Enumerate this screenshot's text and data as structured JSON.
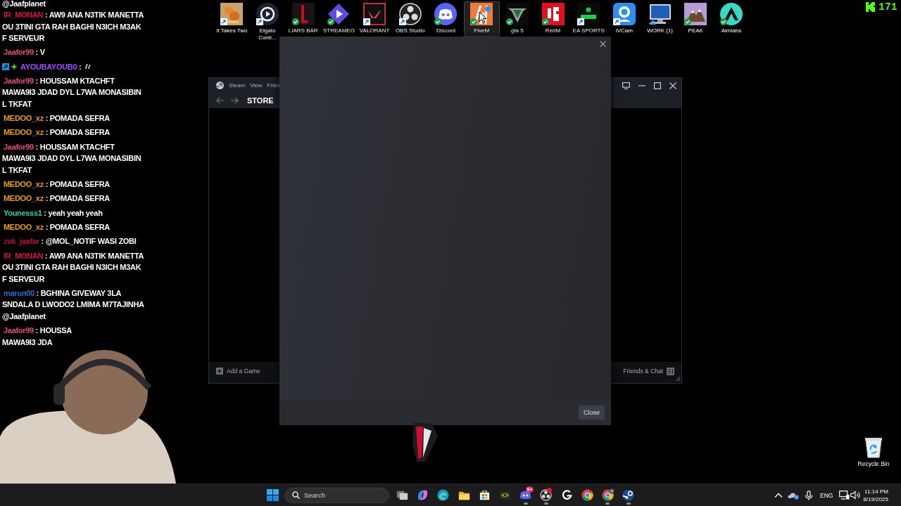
{
  "chat": {
    "leading_text": "@Jaafplanet",
    "messages": [
      {
        "kind": "text",
        "user": "IR_MONAN",
        "color": "#d5173f",
        "badges": false,
        "text": ": AW9 ANA N3TIK MANETTA OU 3TINI GTA RAH BAGHI N3ICH M3AK F SERVEUR"
      },
      {
        "kind": "text",
        "user": "Jaafor99",
        "color": "#e0507c",
        "badges": false,
        "text": ": V"
      },
      {
        "kind": "emote",
        "user": "AYOUBAYOUB0",
        "color": "#9b4dff",
        "badges": true,
        "text": ":"
      },
      {
        "kind": "text",
        "user": "Jaafor99",
        "color": "#e0507c",
        "badges": false,
        "text": ": HOUSSAM KTACHFT MAWA9I3 JDAD DYL L7WA MONASIBIN L TKFAT"
      },
      {
        "kind": "text",
        "user": "MEDOO_xz",
        "color": "#eb9c1e",
        "badges": false,
        "text": ": POMADA SEFRA"
      },
      {
        "kind": "text",
        "user": "MEDOO_xz",
        "color": "#eb9c1e",
        "badges": false,
        "text": ": POMADA SEFRA"
      },
      {
        "kind": "text",
        "user": "Jaafor99",
        "color": "#e0507c",
        "badges": false,
        "text": ": HOUSSAM KTACHFT MAWA9I3 JDAD DYL L7WA MONASIBIN L TKFAT"
      },
      {
        "kind": "text",
        "user": "MEDOO_xz",
        "color": "#eb9c1e",
        "badges": false,
        "text": ": POMADA SEFRA"
      },
      {
        "kind": "text",
        "user": "MEDOO_xz",
        "color": "#eb9c1e",
        "badges": false,
        "text": ": POMADA SEFRA"
      },
      {
        "kind": "text",
        "user": "Younesss1",
        "color": "#3ad1a1",
        "badges": false,
        "text": ": yeah yeah yeah"
      },
      {
        "kind": "text",
        "user": "MEDOO_xz",
        "color": "#eb9c1e",
        "badges": false,
        "text": ": POMADA SEFRA"
      },
      {
        "kind": "text",
        "user": "zok_jaafar",
        "color": "#b3123c",
        "badges": false,
        "text": ": @MOL_NOTIF WASI ZOBI"
      },
      {
        "kind": "text",
        "user": "IR_MONAN",
        "color": "#d5173f",
        "badges": false,
        "text": ": AW9 ANA N3TIK MANETTA OU 3TINI GTA RAH BAGHI N3ICH M3AK F SERVEUR"
      },
      {
        "kind": "text",
        "user": "marun00",
        "color": "#2e6cd6",
        "badges": false,
        "text": ": BGHINA GIVEWAY 3LA SNDALA D LWODO2 LMIMA M7TAJINHA @Jaafplanet"
      },
      {
        "kind": "clipped",
        "user": "Jaafor99",
        "color": "#e0507c",
        "badges": false,
        "lines": [
          ": HOUSSA",
          "MAWA9I3 JDA"
        ]
      }
    ]
  },
  "desktop_icons": [
    {
      "label": "It Takes Two",
      "shortcut": true,
      "synced": false,
      "cloud": false,
      "selected": false
    },
    {
      "label": "Elgato Contr...",
      "shortcut": true,
      "synced": false,
      "cloud": false,
      "selected": false
    },
    {
      "label": "LIARS BAR",
      "shortcut": false,
      "synced": true,
      "cloud": false,
      "selected": false
    },
    {
      "label": "STREAMEO",
      "shortcut": false,
      "synced": true,
      "cloud": false,
      "selected": false
    },
    {
      "label": "VALORANT",
      "shortcut": true,
      "synced": false,
      "cloud": false,
      "selected": false
    },
    {
      "label": "OBS Studio",
      "shortcut": true,
      "synced": false,
      "cloud": false,
      "selected": false
    },
    {
      "label": "Discord",
      "shortcut": false,
      "synced": true,
      "cloud": false,
      "selected": false
    },
    {
      "label": "FiveM",
      "shortcut": false,
      "synced": true,
      "cloud": false,
      "selected": true
    },
    {
      "label": "gta 5",
      "shortcut": false,
      "synced": true,
      "cloud": false,
      "selected": false
    },
    {
      "label": "RedM",
      "shortcut": false,
      "synced": true,
      "cloud": false,
      "selected": false
    },
    {
      "label": "EA SPORTS",
      "shortcut": true,
      "synced": false,
      "cloud": false,
      "selected": false
    },
    {
      "label": "iVCam",
      "shortcut": true,
      "synced": false,
      "cloud": false,
      "selected": false
    },
    {
      "label": "WORK (1)",
      "shortcut": false,
      "synced": false,
      "cloud": true,
      "selected": false
    },
    {
      "label": "PEAK",
      "shortcut": false,
      "synced": true,
      "cloud": false,
      "selected": false
    },
    {
      "label": "Aimlabs",
      "shortcut": false,
      "synced": true,
      "cloud": false,
      "selected": false
    }
  ],
  "viewer_count": "171",
  "steam_window": {
    "menu": [
      "Steam",
      "View",
      "Frien"
    ],
    "title": "STORE",
    "add_game": "Add a Game",
    "friends": "Friends & Chat"
  },
  "dialog": {
    "button": "Close"
  },
  "recycle_bin": {
    "label": "Recycle Bin"
  },
  "taskbar": {
    "search": {
      "placeholder": "Search"
    },
    "apps": [
      {
        "running": false,
        "alert": false
      },
      {
        "running": false,
        "alert": false
      },
      {
        "running": false,
        "alert": false
      },
      {
        "running": false,
        "alert": false
      },
      {
        "running": false,
        "alert": false
      },
      {
        "running": false,
        "alert": false
      },
      {
        "running": true,
        "alert": false,
        "badge": "9+"
      },
      {
        "running": true,
        "alert": true
      },
      {
        "running": false,
        "alert": false
      },
      {
        "running": false,
        "alert": false
      },
      {
        "running": true,
        "alert": false
      },
      {
        "running": true,
        "alert": false
      }
    ],
    "language": "ENG",
    "time": "11:14 PM",
    "date": "8/19/2025"
  }
}
